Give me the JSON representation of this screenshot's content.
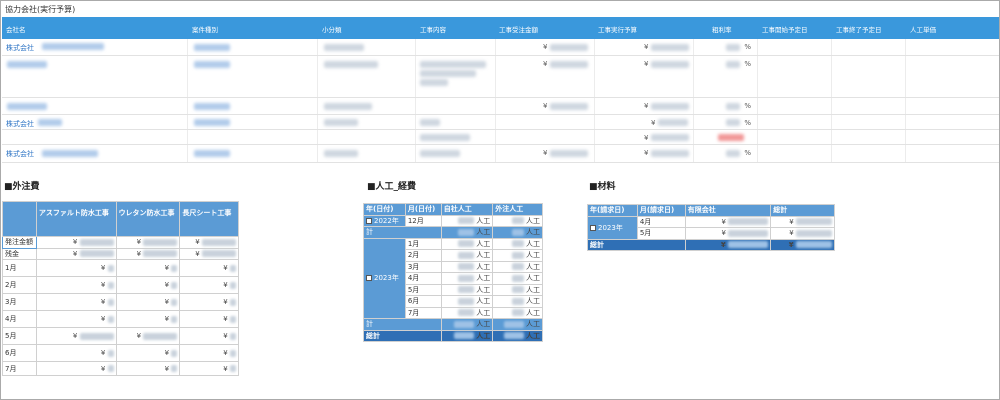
{
  "page": {
    "title": "協力会社(実行予算)"
  },
  "main_table": {
    "headers": [
      "会社名",
      "案件種別",
      "小分類",
      "工事内容",
      "工事受注金額",
      "工事実行予算",
      "粗利率",
      "工事開始予定日",
      "工事終了予定日",
      "人工単価"
    ],
    "currency": "¥",
    "percent": "%",
    "rows": [
      {
        "company": "株式会社"
      },
      {
        "company": ""
      },
      {
        "company": ""
      },
      {
        "company": "株式会社"
      },
      {
        "company": ""
      },
      {
        "company": "株式会社"
      }
    ]
  },
  "gaichu": {
    "title": "■外注費",
    "columns": [
      "アスファルト防水工事",
      "ウレタン防水工事",
      "長尺シート工事"
    ],
    "row_labels": [
      "発注金額",
      "残金",
      "1月",
      "2月",
      "3月",
      "4月",
      "5月",
      "6月",
      "7月"
    ],
    "currency": "¥"
  },
  "jinko": {
    "title": "■人工_経費",
    "headers": [
      "年(日付)",
      "月(日付)",
      "自社人工",
      "外注人工"
    ],
    "year_2022": "2022年",
    "year_2023": "2023年",
    "month_2022": "12月",
    "months_2023": [
      "1月",
      "2月",
      "3月",
      "4月",
      "5月",
      "6月",
      "7月"
    ],
    "subtotal_label": "計",
    "grand_total_label": "総計",
    "unit": "人工"
  },
  "zairyo": {
    "title": "■材料",
    "headers": [
      "年(請求日)",
      "月(請求日)",
      "有限会社",
      "総計"
    ],
    "year": "2023年",
    "months": [
      "4月",
      "5月"
    ],
    "grand_total_label": "総計",
    "currency": "¥"
  }
}
